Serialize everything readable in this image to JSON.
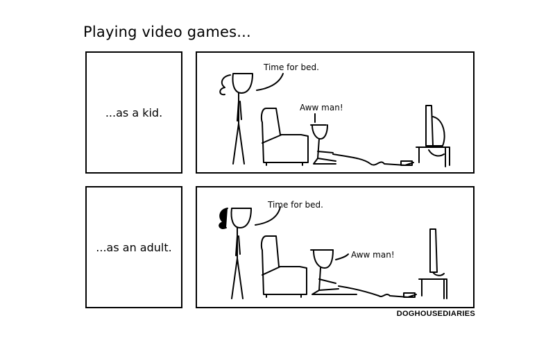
{
  "title": "Playing video games...",
  "rows": [
    {
      "caption": "...as a kid.",
      "bubble_parent": "Time for bed.",
      "bubble_player": "Aww man!"
    },
    {
      "caption": "...as an adult.",
      "bubble_parent": "Time for bed.",
      "bubble_player": "Aww man!"
    }
  ],
  "credit": "DOGHOUSEDIARIES"
}
